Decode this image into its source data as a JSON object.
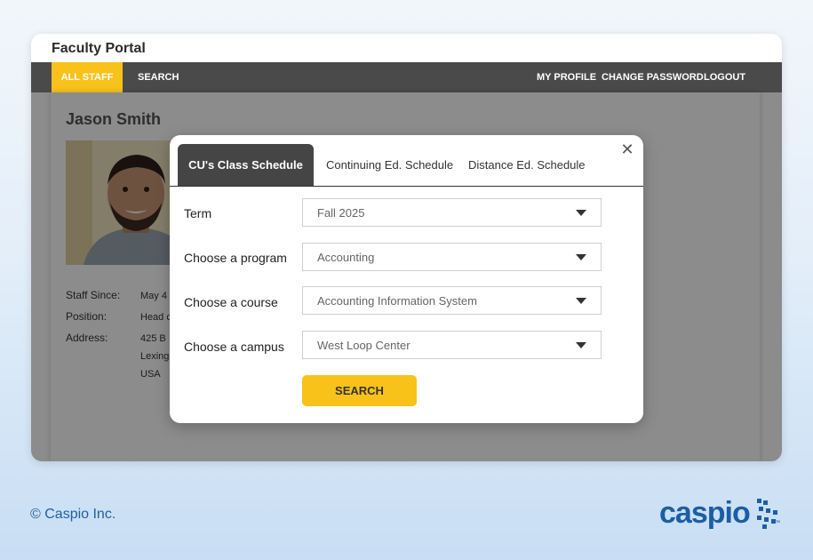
{
  "app": {
    "title": "Faculty Portal"
  },
  "nav": {
    "left": [
      "ALL STAFF",
      "SEARCH"
    ],
    "right": [
      "MY PROFILE",
      "CHANGE PASSWORD",
      "LOGOUT"
    ],
    "active": "ALL STAFF",
    "active_color": "#f8c21b"
  },
  "profile": {
    "name": "Jason Smith",
    "fields": [
      {
        "label": "Staff Since:",
        "value": "May 4"
      },
      {
        "label": "Position:",
        "value": "Head c"
      },
      {
        "label": "Address:",
        "value": "425 B"
      }
    ],
    "address_lines": [
      "Lexing",
      "USA"
    ]
  },
  "modal": {
    "tabs": [
      "CU's Class Schedule",
      "Continuing Ed. Schedule",
      "Distance Ed. Schedule"
    ],
    "active_tab": "CU's Class Schedule",
    "close_icon": "close-icon",
    "fields": [
      {
        "label": "Term",
        "value": "Fall 2025"
      },
      {
        "label": "Choose a program",
        "value": "Accounting"
      },
      {
        "label": "Choose a course",
        "value": "Accounting Information System"
      },
      {
        "label": "Choose a campus",
        "value": "West Loop Center"
      }
    ],
    "search_label": "SEARCH"
  },
  "footer": {
    "copyright": "© Caspio Inc.",
    "logo_text": "caspio",
    "logo_mark": "™"
  }
}
